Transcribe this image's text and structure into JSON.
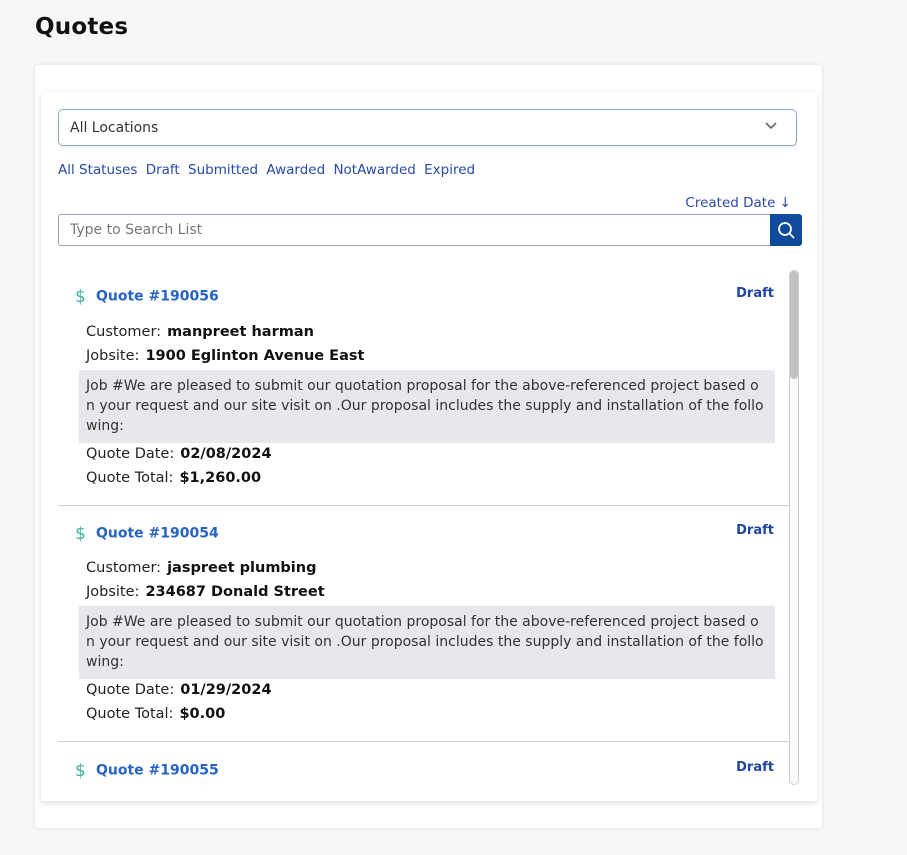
{
  "page": {
    "title": "Quotes"
  },
  "filters": {
    "location_value": "All Locations",
    "statuses": [
      "All Statuses",
      "Draft",
      "Submitted",
      "Awarded",
      "NotAwarded",
      "Expired"
    ],
    "sort_label": "Created Date ↓"
  },
  "search": {
    "placeholder": "Type to Search List",
    "icon": "search-icon"
  },
  "labels": {
    "customer": "Customer:",
    "jobsite": "Jobsite:",
    "quote_date": "Quote Date:",
    "quote_total": "Quote Total:",
    "currency_icon": "$"
  },
  "colors": {
    "accent": "#0f4a9c",
    "link": "#2a4aa6",
    "quote_link": "#2563c4",
    "dollar_icon": "#3ab3a0",
    "desc_bg": "#e6e8eb"
  },
  "quotes": [
    {
      "number": "Quote #190056",
      "status": "Draft",
      "customer": "manpreet harman",
      "jobsite": "1900 Eglinton Avenue East",
      "description": "Job #We are pleased to submit our quotation proposal for the above-referenced project based on your request and our site visit on .Our proposal includes the supply and installation of the following:",
      "quote_date": "02/08/2024",
      "quote_total": "$1,260.00"
    },
    {
      "number": "Quote #190054",
      "status": "Draft",
      "customer": "jaspreet plumbing",
      "jobsite": "234687 Donald Street",
      "description": "Job #We are pleased to submit our quotation proposal for the above-referenced project based on your request and our site visit on .Our proposal includes the supply and installation of the following:",
      "quote_date": "01/29/2024",
      "quote_total": "$0.00"
    },
    {
      "number": "Quote #190055",
      "status": "Draft"
    }
  ]
}
